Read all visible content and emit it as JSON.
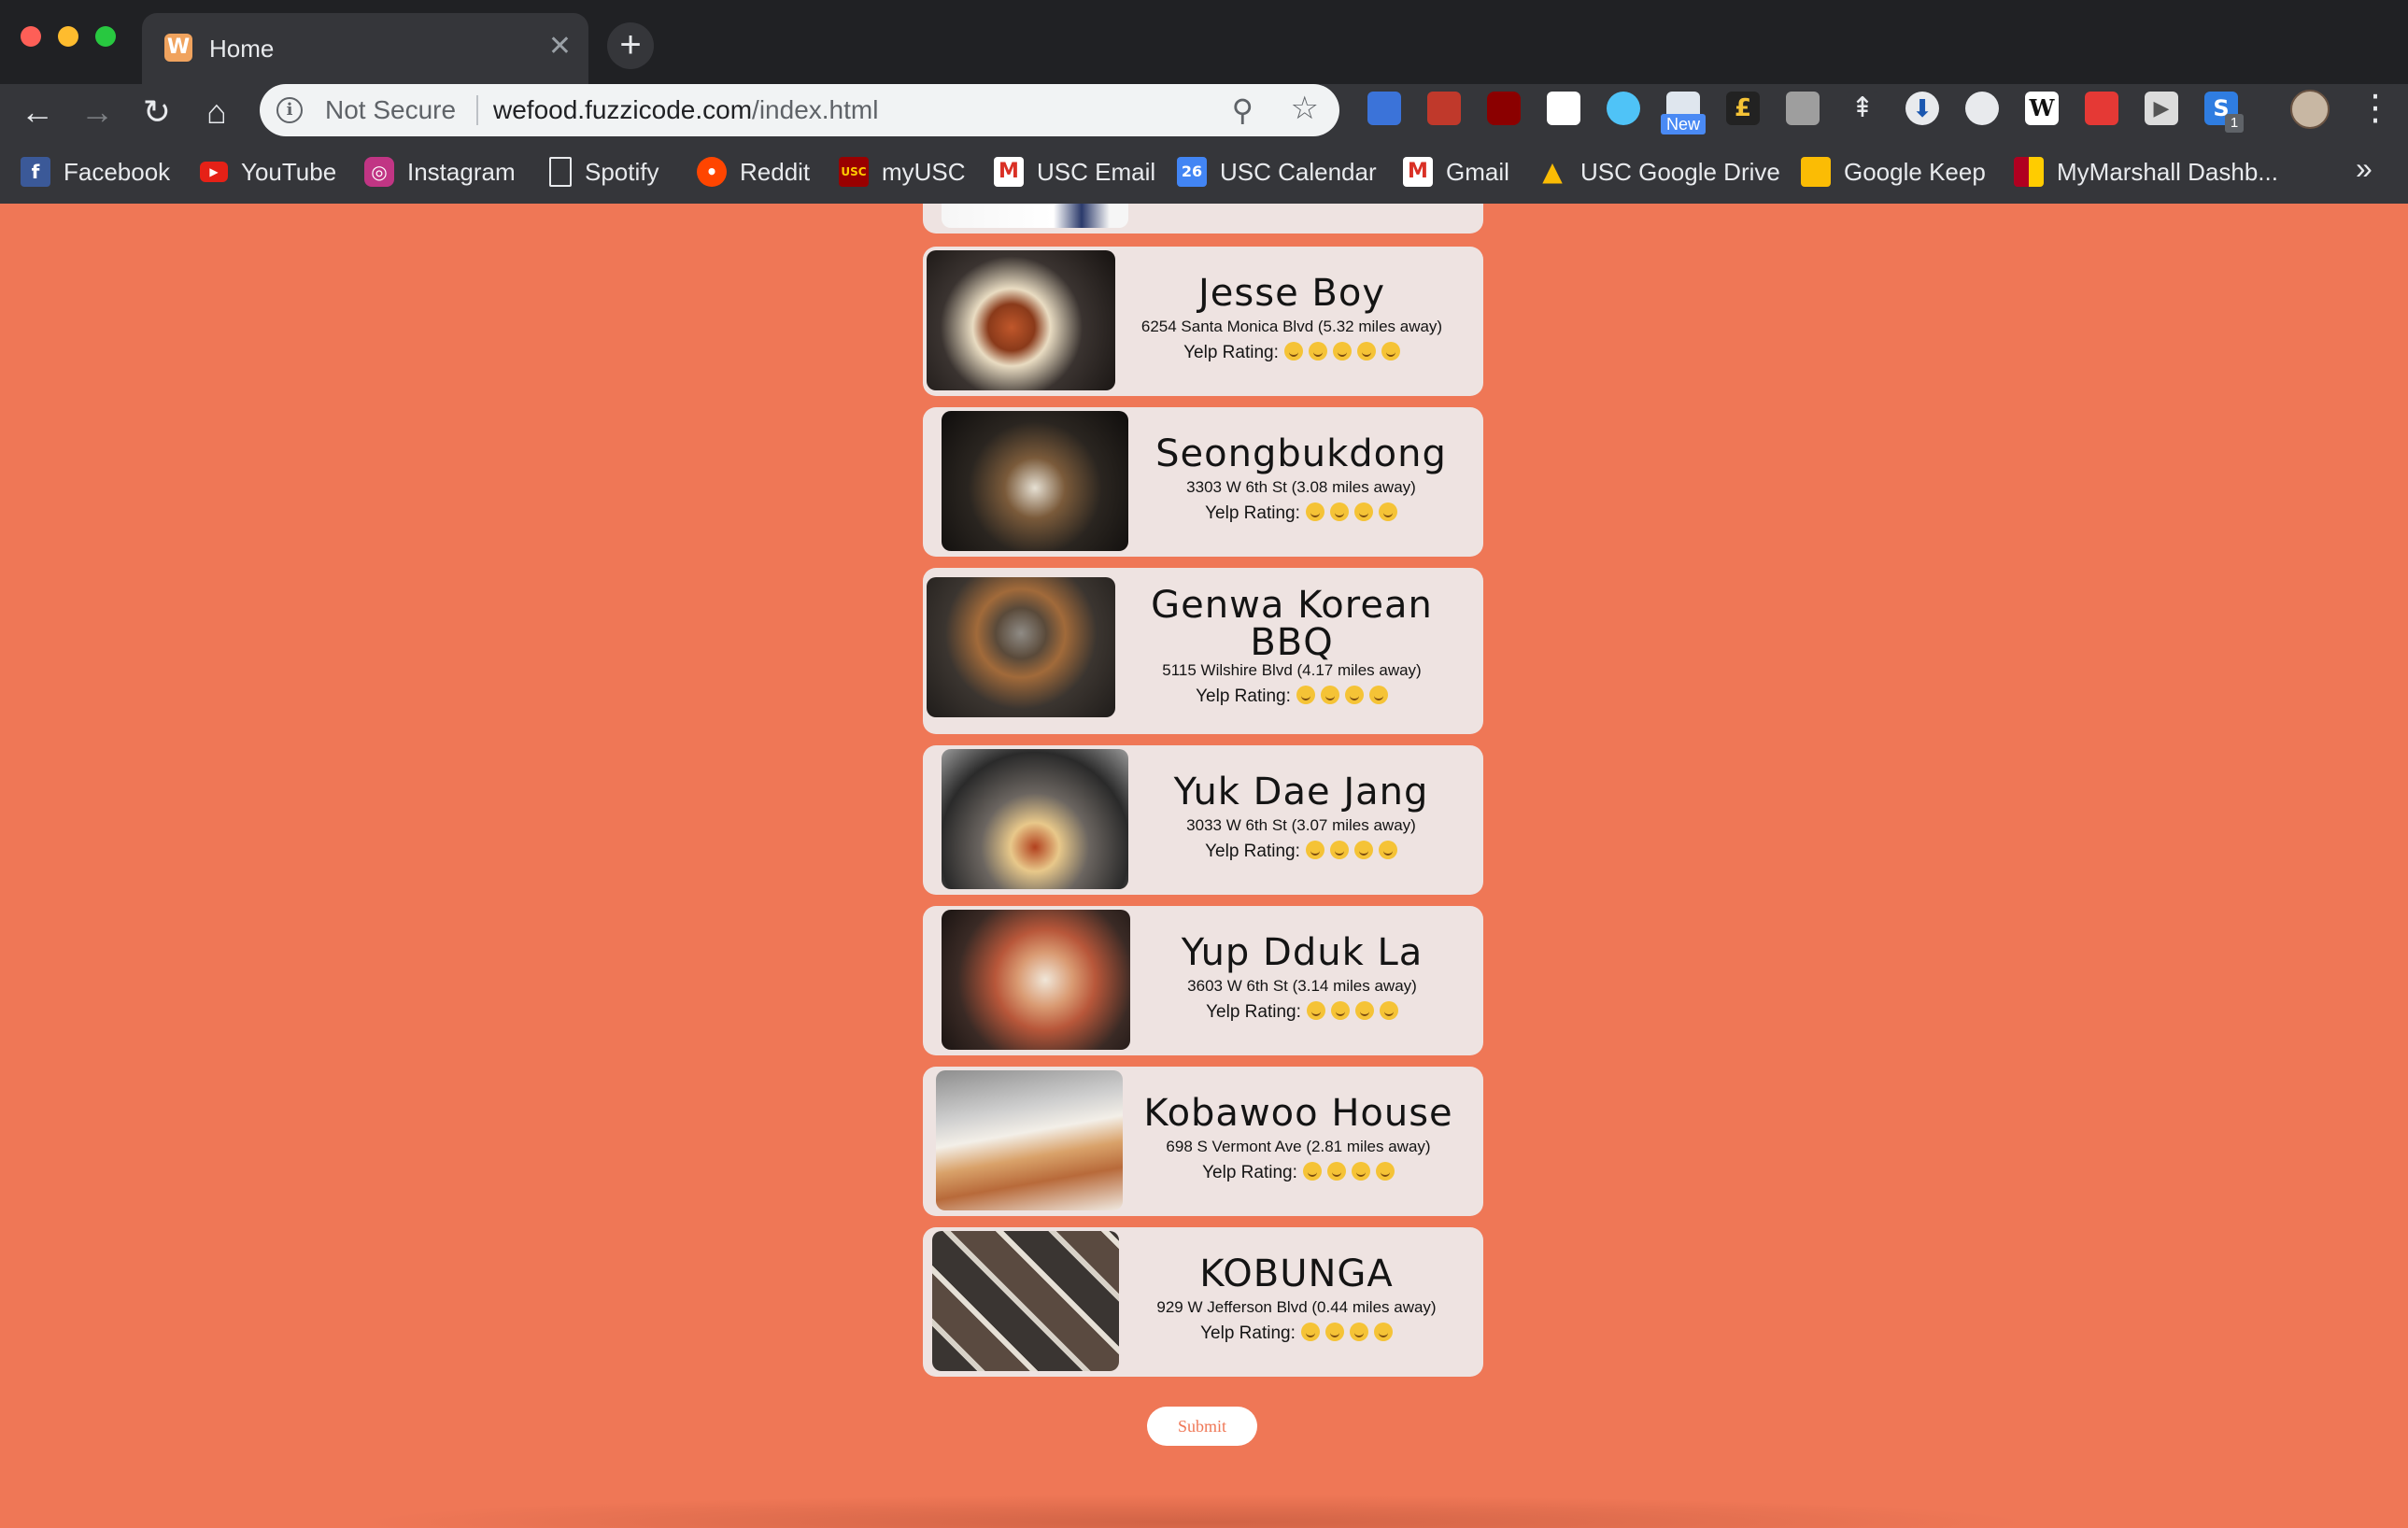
{
  "browser": {
    "tab_title": "Home",
    "tab_favicon": "W",
    "security_label": "Not Secure",
    "url_host": "wefood.fuzzicode.com",
    "url_path": "/index.html",
    "extension_new_badge": "New",
    "extension_count_badge": "1",
    "bookmarks": [
      {
        "label": "Facebook",
        "icon": "facebook-icon"
      },
      {
        "label": "YouTube",
        "icon": "youtube-icon"
      },
      {
        "label": "Instagram",
        "icon": "instagram-icon"
      },
      {
        "label": "Spotify",
        "icon": "document-icon"
      },
      {
        "label": "Reddit",
        "icon": "reddit-icon"
      },
      {
        "label": "myUSC",
        "icon": "usc-icon"
      },
      {
        "label": "USC Email",
        "icon": "gmail-icon"
      },
      {
        "label": "USC Calendar",
        "icon": "calendar-icon"
      },
      {
        "label": "Gmail",
        "icon": "gmail-icon"
      },
      {
        "label": "USC Google Drive",
        "icon": "drive-icon"
      },
      {
        "label": "Google Keep",
        "icon": "keep-icon"
      },
      {
        "label": "MyMarshall Dashb...",
        "icon": "marshall-icon"
      }
    ],
    "bookmarks_overflow": "»"
  },
  "restaurants": [
    {
      "name": "Jesse Boy",
      "address": "6254 Santa Monica Blvd (5.32 miles away)",
      "rating_label": "Yelp Rating:",
      "rating": 5
    },
    {
      "name": "Seongbukdong",
      "address": "3303 W 6th St (3.08 miles away)",
      "rating_label": "Yelp Rating:",
      "rating": 4
    },
    {
      "name": "Genwa Korean BBQ",
      "address": "5115 Wilshire Blvd (4.17 miles away)",
      "rating_label": "Yelp Rating:",
      "rating": 4
    },
    {
      "name": "Yuk Dae Jang",
      "address": "3033 W 6th St (3.07 miles away)",
      "rating_label": "Yelp Rating:",
      "rating": 4
    },
    {
      "name": "Yup Dduk La",
      "address": "3603 W 6th St (3.14 miles away)",
      "rating_label": "Yelp Rating:",
      "rating": 4
    },
    {
      "name": "Kobawoo House",
      "address": "698 S Vermont Ave (2.81 miles away)",
      "rating_label": "Yelp Rating:",
      "rating": 4
    },
    {
      "name": "KOBUNGA",
      "address": "929 W Jefferson Blvd (0.44 miles away)",
      "rating_label": "Yelp Rating:",
      "rating": 4
    }
  ],
  "submit_label": "Submit",
  "colors": {
    "page_background": "#ef7756",
    "card_background": "#eee3e1"
  }
}
